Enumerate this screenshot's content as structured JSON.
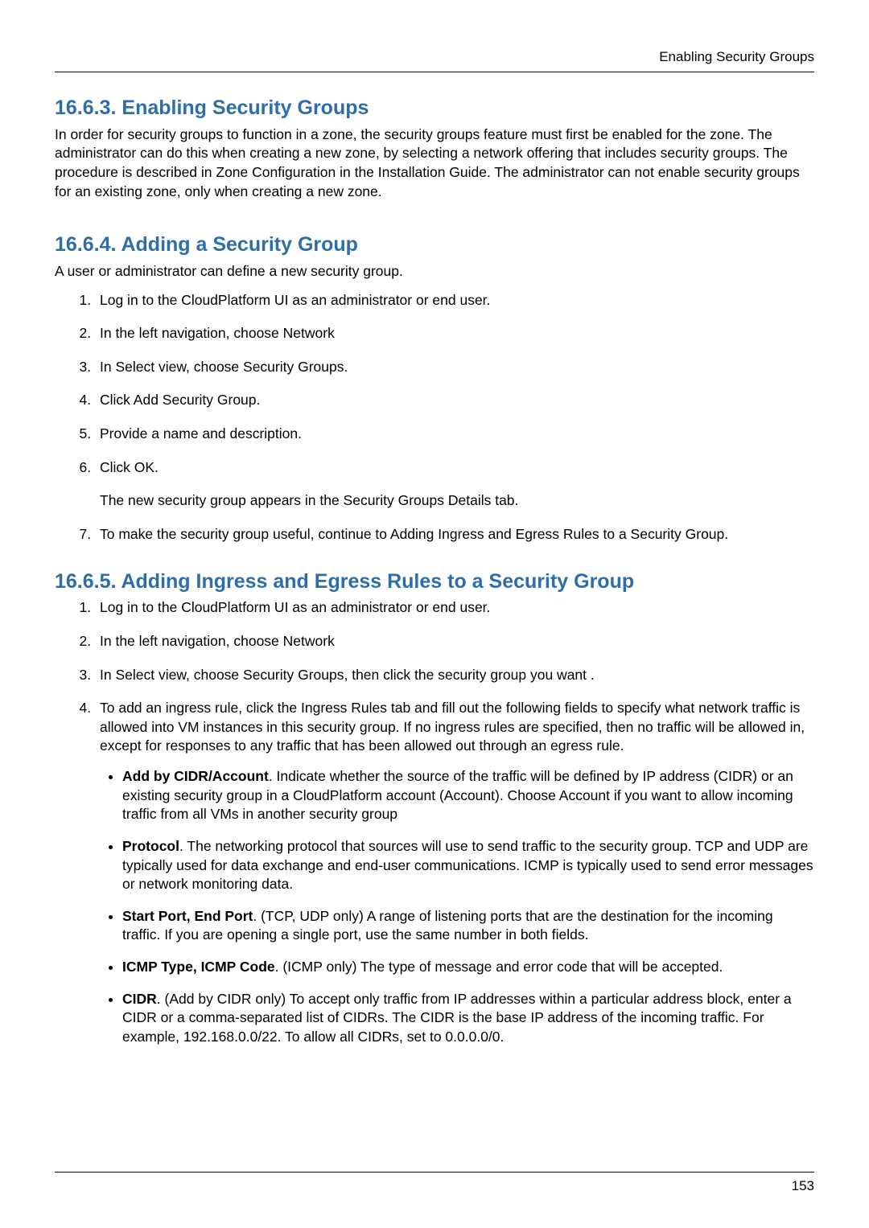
{
  "header": {
    "running_head": "Enabling Security Groups"
  },
  "section1": {
    "title": "16.6.3. Enabling Security Groups",
    "para": "In order for security groups to function in a zone, the security groups feature must first be enabled for the zone. The administrator can do this when creating a new zone, by selecting a network offering that includes security groups. The procedure is described in Zone Configuration in the Installation Guide. The administrator can not enable security groups for an existing zone, only when creating a new zone."
  },
  "section2": {
    "title": "16.6.4. Adding a Security Group",
    "intro": "A user or administrator can define a new security group.",
    "steps": {
      "s1": "Log in to the CloudPlatform UI as an administrator or end user.",
      "s2": "In the left navigation, choose Network",
      "s3": "In Select view, choose Security Groups.",
      "s4": "Click Add Security Group.",
      "s5": "Provide a name and description.",
      "s6": "Click OK.",
      "s6_extra": "The new security group appears in the Security Groups Details tab.",
      "s7": "To make the security group useful, continue to Adding Ingress and Egress Rules to a Security Group."
    }
  },
  "section3": {
    "title": "16.6.5. Adding Ingress and Egress Rules to a Security Group",
    "steps": {
      "s1": "Log in to the CloudPlatform UI as an administrator or end user.",
      "s2": "In the left navigation, choose Network",
      "s3": "In Select view, choose Security Groups, then click the security group you want .",
      "s4_intro": "To add an ingress rule, click the Ingress Rules tab and fill out the following fields to specify what network traffic is allowed into VM instances in this security group. If no ingress rules are specified, then no traffic will be allowed in, except for responses to any traffic that has been allowed out through an egress rule.",
      "s4_bullets": {
        "b1_term": "Add by CIDR/Account",
        "b1_text": ". Indicate whether the source of the traffic will be defined by IP address (CIDR) or an existing security group in a CloudPlatform account (Account). Choose Account if you want to allow incoming traffic from all VMs in another security group",
        "b2_term": "Protocol",
        "b2_text": ". The networking protocol that sources will use to send traffic to the security group. TCP and UDP are typically used for data exchange and end-user communications. ICMP is typically used to send error messages or network monitoring data.",
        "b3_term": "Start Port, End Port",
        "b3_text": ". (TCP, UDP only) A range of listening ports that are the destination for the incoming traffic. If you are opening a single port, use the same number in both fields.",
        "b4_term": "ICMP Type, ICMP Code",
        "b4_text": ". (ICMP only) The type of message and error code that will be accepted.",
        "b5_term": "CIDR",
        "b5_text": ". (Add by CIDR only) To accept only traffic from IP addresses within a particular address block, enter a CIDR or a comma-separated list of CIDRs. The CIDR is the base IP address of the incoming traffic. For example, 192.168.0.0/22. To allow all CIDRs, set to 0.0.0.0/0."
      }
    }
  },
  "footer": {
    "page_number": "153"
  }
}
